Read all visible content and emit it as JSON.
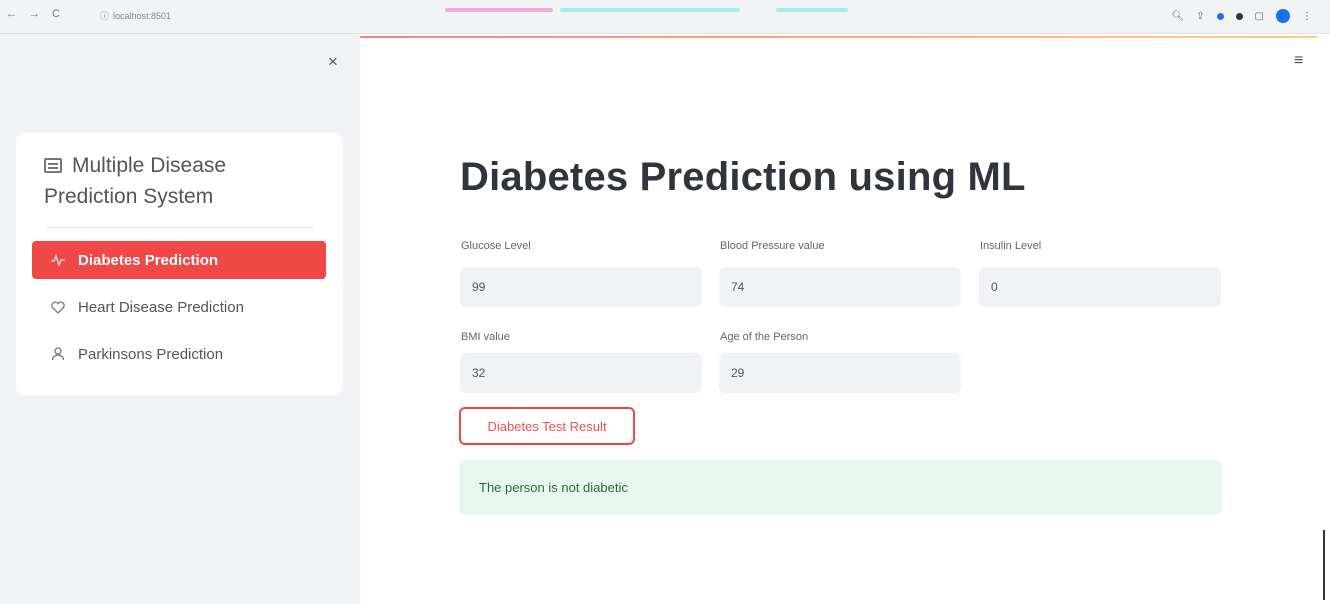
{
  "browser": {
    "url": "localhost:8501",
    "nav_back": "←",
    "nav_forward": "→",
    "nav_reload": "C"
  },
  "sidebar": {
    "close_icon": "×",
    "title": "Multiple Disease Prediction System",
    "items": [
      {
        "label": "Diabetes Prediction",
        "icon": "activity-icon",
        "active": true
      },
      {
        "label": "Heart Disease Prediction",
        "icon": "heart-icon",
        "active": false
      },
      {
        "label": "Parkinsons Prediction",
        "icon": "person-icon",
        "active": false
      }
    ]
  },
  "main": {
    "menu_icon": "≡",
    "title": "Diabetes Prediction using ML",
    "fields": [
      {
        "label": "Glucose Level",
        "value": "99"
      },
      {
        "label": "Blood Pressure value",
        "value": "74"
      },
      {
        "label": "Insulin Level",
        "value": "0"
      },
      {
        "label": "BMI value",
        "value": "32"
      },
      {
        "label": "Age of the Person",
        "value": "29"
      }
    ],
    "button_label": "Diabetes Test Result",
    "result_text": "The person is not diabetic"
  },
  "colors": {
    "accent": "#f04747",
    "sidebar_bg": "#f0f2f6",
    "success_bg": "#e8f7ee",
    "success_text": "#2d6a3e"
  }
}
